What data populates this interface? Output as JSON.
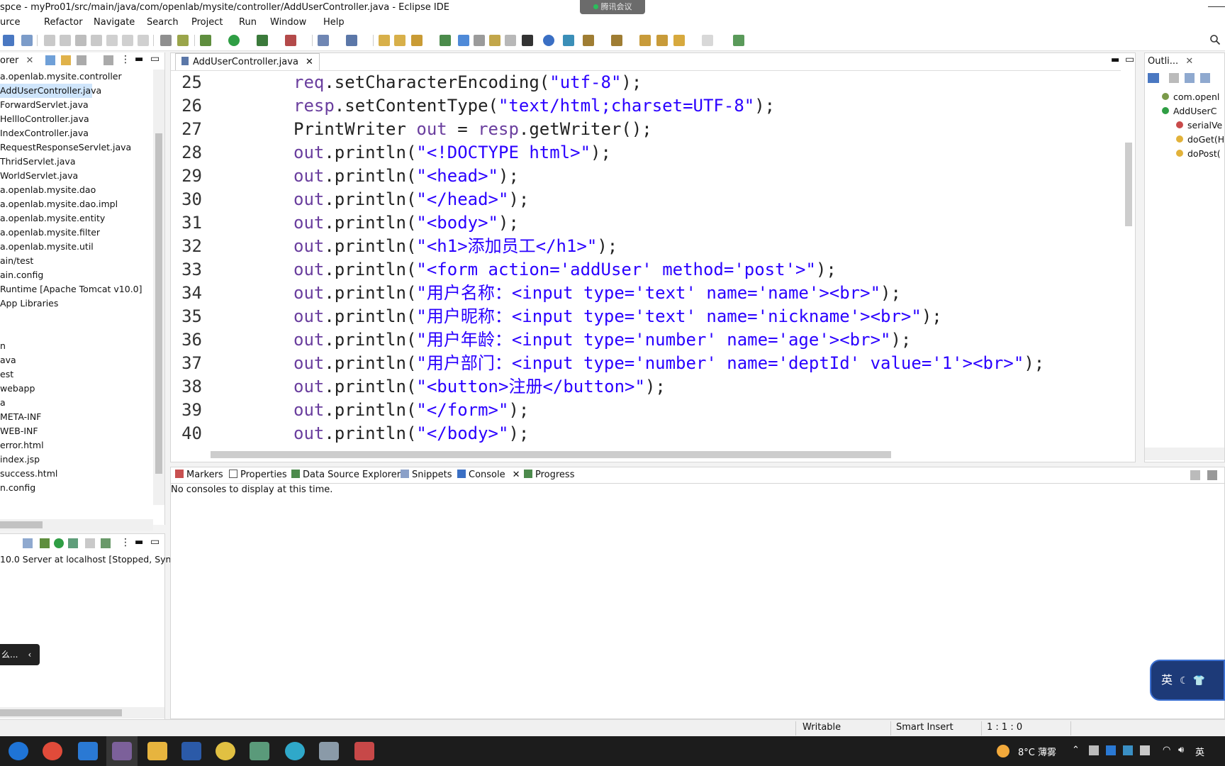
{
  "window": {
    "title": "spce - myPro01/src/main/java/com/openlab/mysite/controller/AddUserController.java - Eclipse IDE",
    "meeting_badge": "腾讯会议"
  },
  "menu": [
    "urce",
    "Refactor",
    "Navigate",
    "Search",
    "Project",
    "Run",
    "Window",
    "Help"
  ],
  "explorer": {
    "tab_label": "orer",
    "items": [
      {
        "label": "a.openlab.mysite.controller",
        "selected": false
      },
      {
        "label": "AddUserController.java",
        "selected": true
      },
      {
        "label": "ForwardServlet.java",
        "selected": false
      },
      {
        "label": "HellloController.java",
        "selected": false
      },
      {
        "label": "IndexController.java",
        "selected": false
      },
      {
        "label": "RequestResponseServlet.java",
        "selected": false
      },
      {
        "label": "ThridServlet.java",
        "selected": false
      },
      {
        "label": "WorldServlet.java",
        "selected": false
      },
      {
        "label": "a.openlab.mysite.dao",
        "selected": false
      },
      {
        "label": "a.openlab.mysite.dao.impl",
        "selected": false
      },
      {
        "label": "a.openlab.mysite.entity",
        "selected": false
      },
      {
        "label": "a.openlab.mysite.filter",
        "selected": false
      },
      {
        "label": "a.openlab.mysite.util",
        "selected": false
      },
      {
        "label": "ain/test",
        "selected": false
      },
      {
        "label": "ain.config",
        "selected": false
      },
      {
        "label": "Runtime [Apache Tomcat v10.0]",
        "selected": false
      },
      {
        "label": "App Libraries",
        "selected": false
      },
      {
        "label": "",
        "selected": false
      },
      {
        "label": "",
        "selected": false
      },
      {
        "label": "n",
        "selected": false
      },
      {
        "label": "ava",
        "selected": false
      },
      {
        "label": "est",
        "selected": false
      },
      {
        "label": "webapp",
        "selected": false
      },
      {
        "label": "a",
        "selected": false
      },
      {
        "label": "META-INF",
        "selected": false
      },
      {
        "label": "WEB-INF",
        "selected": false
      },
      {
        "label": "error.html",
        "selected": false
      },
      {
        "label": "index.jsp",
        "selected": false
      },
      {
        "label": "success.html",
        "selected": false
      },
      {
        "label": "n.config",
        "selected": false
      }
    ]
  },
  "servers": {
    "row": "10.0 Server at localhost  [Stopped, Synch",
    "tooltip": "么..."
  },
  "editor": {
    "tab_label": "AddUserController.java",
    "lines": [
      {
        "n": "25",
        "segs": [
          {
            "t": "req",
            "c": "var"
          },
          {
            "t": ".setCharacterEncoding(",
            "c": ""
          },
          {
            "t": "\"utf-8\"",
            "c": "str"
          },
          {
            "t": ");",
            "c": ""
          }
        ]
      },
      {
        "n": "26",
        "segs": [
          {
            "t": "resp",
            "c": "var"
          },
          {
            "t": ".setContentType(",
            "c": ""
          },
          {
            "t": "\"text/html;charset=UTF-8\"",
            "c": "str"
          },
          {
            "t": ");",
            "c": ""
          }
        ]
      },
      {
        "n": "27",
        "segs": [
          {
            "t": "PrintWriter ",
            "c": ""
          },
          {
            "t": "out",
            "c": "var"
          },
          {
            "t": " = ",
            "c": ""
          },
          {
            "t": "resp",
            "c": "var"
          },
          {
            "t": ".getWriter();",
            "c": ""
          }
        ]
      },
      {
        "n": "28",
        "segs": [
          {
            "t": "out",
            "c": "var"
          },
          {
            "t": ".println(",
            "c": ""
          },
          {
            "t": "\"<!DOCTYPE html>\"",
            "c": "str"
          },
          {
            "t": ");",
            "c": ""
          }
        ]
      },
      {
        "n": "29",
        "segs": [
          {
            "t": "out",
            "c": "var"
          },
          {
            "t": ".println(",
            "c": ""
          },
          {
            "t": "\"<head>\"",
            "c": "str"
          },
          {
            "t": ");",
            "c": ""
          }
        ]
      },
      {
        "n": "30",
        "segs": [
          {
            "t": "out",
            "c": "var"
          },
          {
            "t": ".println(",
            "c": ""
          },
          {
            "t": "\"</head>\"",
            "c": "str"
          },
          {
            "t": ");",
            "c": ""
          }
        ]
      },
      {
        "n": "31",
        "segs": [
          {
            "t": "out",
            "c": "var"
          },
          {
            "t": ".println(",
            "c": ""
          },
          {
            "t": "\"<body>\"",
            "c": "str"
          },
          {
            "t": ");",
            "c": ""
          }
        ]
      },
      {
        "n": "32",
        "segs": [
          {
            "t": "out",
            "c": "var"
          },
          {
            "t": ".println(",
            "c": ""
          },
          {
            "t": "\"<h1>添加员工</h1>\"",
            "c": "str"
          },
          {
            "t": ");",
            "c": ""
          }
        ]
      },
      {
        "n": "33",
        "segs": [
          {
            "t": "out",
            "c": "var"
          },
          {
            "t": ".println(",
            "c": ""
          },
          {
            "t": "\"<form action='addUser' method='post'>\"",
            "c": "str"
          },
          {
            "t": ");",
            "c": ""
          }
        ]
      },
      {
        "n": "34",
        "segs": [
          {
            "t": "out",
            "c": "var"
          },
          {
            "t": ".println(",
            "c": ""
          },
          {
            "t": "\"用户名称：<input type='text' name='name'><br>\"",
            "c": "str"
          },
          {
            "t": ");",
            "c": ""
          }
        ]
      },
      {
        "n": "35",
        "segs": [
          {
            "t": "out",
            "c": "var"
          },
          {
            "t": ".println(",
            "c": ""
          },
          {
            "t": "\"用户昵称：<input type='text' name='nickname'><br>\"",
            "c": "str"
          },
          {
            "t": ");",
            "c": ""
          }
        ]
      },
      {
        "n": "36",
        "segs": [
          {
            "t": "out",
            "c": "var"
          },
          {
            "t": ".println(",
            "c": ""
          },
          {
            "t": "\"用户年龄：<input type='number' name='age'><br>\"",
            "c": "str"
          },
          {
            "t": ");",
            "c": ""
          }
        ]
      },
      {
        "n": "37",
        "segs": [
          {
            "t": "out",
            "c": "var"
          },
          {
            "t": ".println(",
            "c": ""
          },
          {
            "t": "\"用户部门：<input type='number' name='deptId' value='1'><br>\"",
            "c": "str"
          },
          {
            "t": ");",
            "c": ""
          }
        ]
      },
      {
        "n": "38",
        "segs": [
          {
            "t": "out",
            "c": "var"
          },
          {
            "t": ".println(",
            "c": ""
          },
          {
            "t": "\"<button>注册</button>\"",
            "c": "str"
          },
          {
            "t": ");",
            "c": ""
          }
        ]
      },
      {
        "n": "39",
        "segs": [
          {
            "t": "out",
            "c": "var"
          },
          {
            "t": ".println(",
            "c": ""
          },
          {
            "t": "\"</form>\"",
            "c": "str"
          },
          {
            "t": ");",
            "c": ""
          }
        ]
      },
      {
        "n": "40",
        "segs": [
          {
            "t": "out",
            "c": "var"
          },
          {
            "t": ".println(",
            "c": ""
          },
          {
            "t": "\"</body>\"",
            "c": "str"
          },
          {
            "t": ");",
            "c": ""
          }
        ]
      }
    ]
  },
  "outline": {
    "tab_label": "Outli...",
    "items": [
      "com.openl",
      "AddUserC",
      "serialVe",
      "doGet(H",
      "doPost("
    ]
  },
  "console": {
    "tabs": [
      "Markers",
      "Properties",
      "Data Source Explorer",
      "Snippets",
      "Console",
      "Progress"
    ],
    "active": "Console",
    "message": "No consoles to display at this time."
  },
  "status": {
    "writable": "Writable",
    "insert_mode": "Smart Insert",
    "position": "1 : 1 : 0"
  },
  "ime": {
    "label": "英"
  },
  "taskbar": {
    "weather": "8°C  薄雾",
    "lang": "英"
  },
  "colors": {
    "string": "#2a00ff",
    "variable": "#6a3e9e",
    "selection": "#cfe5fb"
  }
}
